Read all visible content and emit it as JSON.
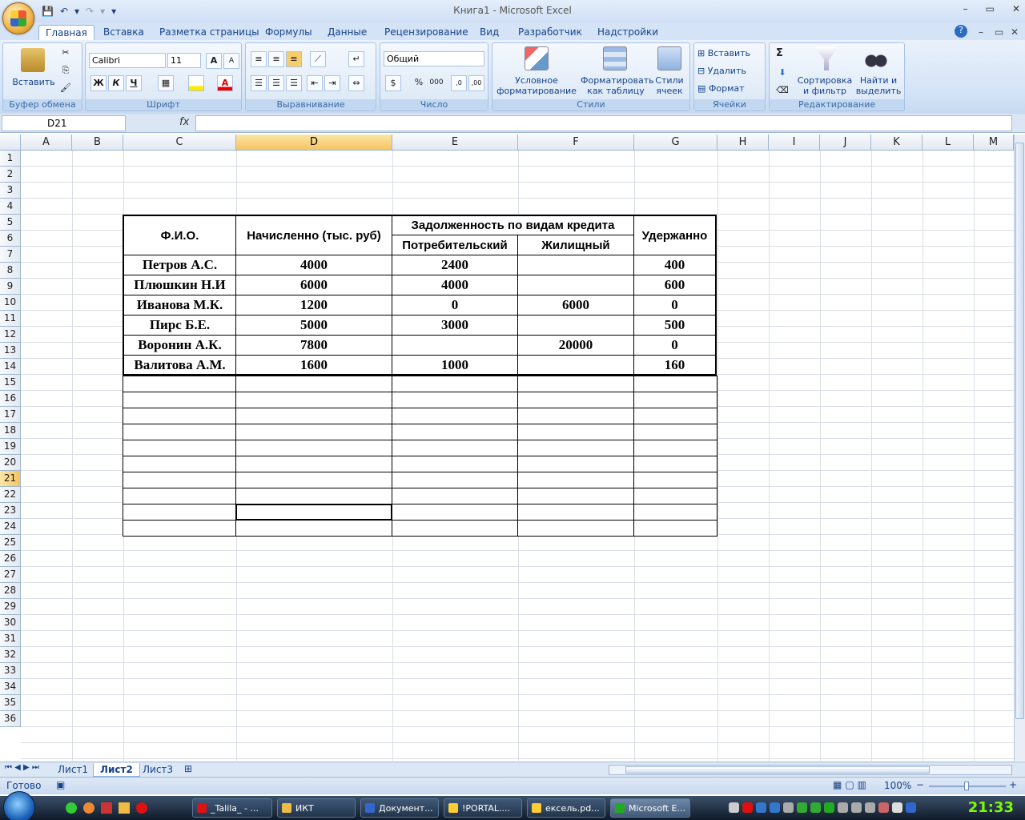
{
  "window": {
    "title": "Книга1 - Microsoft Excel",
    "min": "–",
    "restore": "▭",
    "close": "✕"
  },
  "qat": {
    "save": "💾",
    "undo": "↶",
    "undo_drop": "▾",
    "redo": "↷",
    "redo_drop": "▾",
    "custom": "▾"
  },
  "ribbon_tabs": [
    {
      "label": "Главная"
    },
    {
      "label": "Вставка"
    },
    {
      "label": "Разметка страницы"
    },
    {
      "label": "Формулы"
    },
    {
      "label": "Данные"
    },
    {
      "label": "Рецензирование"
    },
    {
      "label": "Вид"
    },
    {
      "label": "Разработчик"
    },
    {
      "label": "Надстройки"
    }
  ],
  "help": "?",
  "ribbon_min": "–",
  "ribbon_restore": "▭",
  "ribbon_close": "✕",
  "groups": {
    "clipboard": {
      "label": "Буфер обмена",
      "paste": "Вставить"
    },
    "font": {
      "label": "Шрифт",
      "font_name": "Calibri",
      "font_size": "11",
      "bold": "Ж",
      "italic": "К",
      "underline": "Ч",
      "grow": "A",
      "shrink": "A",
      "color": "A"
    },
    "align": {
      "label": "Выравнивание"
    },
    "number": {
      "label": "Число",
      "format": "Общий",
      "percent": "%",
      "thousands": "000",
      "inc": ",0",
      "dec": ",00"
    },
    "styles": {
      "label": "Стили",
      "cond1": "Условное",
      "cond2": "форматирование",
      "table1": "Форматировать",
      "table2": "как таблицу",
      "cell1": "Стили",
      "cell2": "ячеек"
    },
    "cells": {
      "label": "Ячейки",
      "insert": "Вставить",
      "delete": "Удалить",
      "format": "Формат"
    },
    "editing": {
      "label": "Редактирование",
      "sort1": "Сортировка",
      "sort2": "и фильтр",
      "find1": "Найти и",
      "find2": "выделить",
      "sigma": "Σ"
    }
  },
  "formula_bar": {
    "name_box": "D21",
    "fx": "fx",
    "value": ""
  },
  "columns": [
    "A",
    "B",
    "C",
    "D",
    "E",
    "F",
    "G",
    "H",
    "I",
    "J",
    "K",
    "L",
    "M"
  ],
  "rows": [
    "1",
    "2",
    "3",
    "4",
    "5",
    "6",
    "7",
    "8",
    "9",
    "10",
    "11",
    "12",
    "13",
    "14",
    "15",
    "16",
    "17",
    "18",
    "19",
    "20",
    "21",
    "22",
    "23",
    "24",
    "25",
    "26",
    "27",
    "28",
    "29",
    "30",
    "31",
    "32",
    "33",
    "34",
    "35",
    "36"
  ],
  "selected": {
    "col": "D",
    "row": "21"
  },
  "table": {
    "h_fio": "Ф.И.О.",
    "h_accrued": "Начисленно (тыс. руб)",
    "h_debt": "Задолженность по видам кредита",
    "h_consumer": "Потребительский",
    "h_housing": "Жилищный",
    "h_withheld": "Удержанно",
    "rows": [
      {
        "fio": "Петров А.С.",
        "accrued": "4000",
        "consumer": "2400",
        "housing": "",
        "withheld": "400"
      },
      {
        "fio": "Плюшкин Н.И",
        "accrued": "6000",
        "consumer": "4000",
        "housing": "",
        "withheld": "600"
      },
      {
        "fio": "Иванова М.К.",
        "accrued": "1200",
        "consumer": "0",
        "housing": "6000",
        "withheld": "0"
      },
      {
        "fio": "Пирс Б.Е.",
        "accrued": "5000",
        "consumer": "3000",
        "housing": "",
        "withheld": "500"
      },
      {
        "fio": "Воронин А.К.",
        "accrued": "7800",
        "consumer": "",
        "housing": "20000",
        "withheld": "0"
      },
      {
        "fio": "Валитова А.М.",
        "accrued": "1600",
        "consumer": "1000",
        "housing": "",
        "withheld": "160"
      }
    ]
  },
  "sheets": [
    {
      "label": "Лист1"
    },
    {
      "label": "Лист2"
    },
    {
      "label": "Лист3"
    }
  ],
  "status": {
    "ready": "Готово",
    "zoom": "100%",
    "minus": "−",
    "plus": "+"
  },
  "taskbar": {
    "items": [
      {
        "label": "_Talila_ - ..."
      },
      {
        "label": "ИКТ"
      },
      {
        "label": "Документ..."
      },
      {
        "label": "!PORTAL...."
      },
      {
        "label": "ексель.pd..."
      },
      {
        "label": "Microsoft E..."
      }
    ],
    "clock": "21:33"
  }
}
